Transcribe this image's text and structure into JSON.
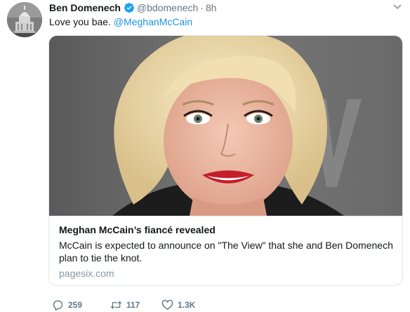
{
  "author": {
    "name": "Ben Domenech",
    "verified": true,
    "handle": "@bdomenech",
    "separator": "·",
    "time": "8h",
    "avatar_icon": "capitol-building-avatar"
  },
  "tweet": {
    "text": "Love you bae.",
    "mention": "@MeghanMcCain"
  },
  "card": {
    "image_icon": "portrait-photo",
    "title": "Meghan McCain’s fiancé revealed",
    "description": "McCain is expected to announce on \"The View\" that she and Ben Domenech plan to tie the knot.",
    "domain": "pagesix.com"
  },
  "actions": {
    "replies": "259",
    "retweets": "117",
    "likes": "1.3K"
  },
  "colors": {
    "link": "#1b95e0",
    "secondary_text": "#657786",
    "verified_badge": "#1da1f2",
    "border": "#e1e8ed"
  }
}
